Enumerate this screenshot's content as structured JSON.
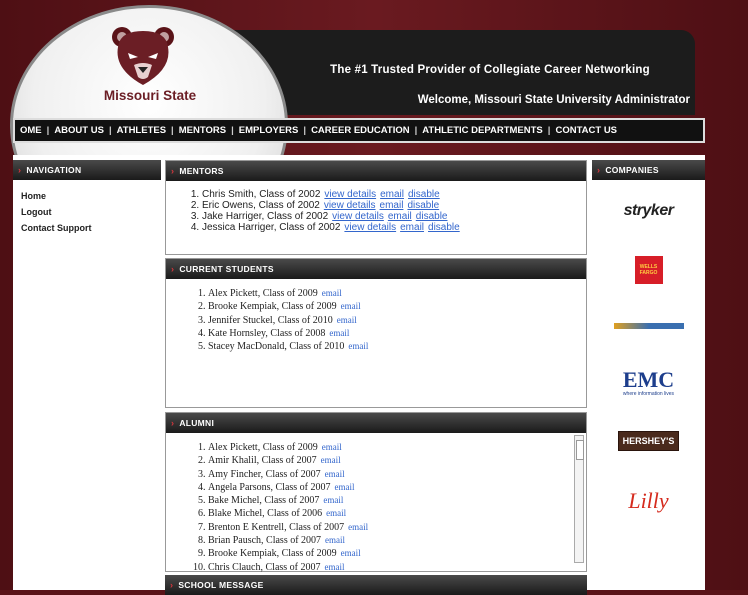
{
  "header": {
    "tagline": "The #1 Trusted Provider of Collegiate Career Networking",
    "welcome": "Welcome, Missouri State University Administrator",
    "school_name": "Missouri State"
  },
  "nav": [
    "OME",
    "ABOUT US",
    "ATHLETES",
    "MENTORS",
    "EMPLOYERS",
    "CAREER EDUCATION",
    "ATHLETIC DEPARTMENTS",
    "CONTACT US"
  ],
  "sidebar": {
    "title": "NAVIGATION",
    "items": [
      "Home",
      "Logout",
      "Contact Support"
    ]
  },
  "mentors": {
    "title": "MENTORS",
    "items": [
      {
        "text": "Chris Smith, Class of 2002",
        "links": [
          "view details",
          "email",
          "disable"
        ]
      },
      {
        "text": "Eric Owens, Class of 2002",
        "links": [
          "view details",
          "email",
          "disable"
        ]
      },
      {
        "text": "Jake Harriger, Class of 2002",
        "links": [
          "view details",
          "email",
          "disable"
        ]
      },
      {
        "text": "Jessica Harriger, Class of 2002",
        "links": [
          "view details",
          "email",
          "disable"
        ]
      }
    ]
  },
  "current_students": {
    "title": "CURRENT STUDENTS",
    "items": [
      {
        "text": "Alex Pickett, Class of 2009",
        "link": "email"
      },
      {
        "text": "Brooke Kempiak, Class of 2009",
        "link": "email"
      },
      {
        "text": "Jennifer Stuckel, Class of 2010",
        "link": "email"
      },
      {
        "text": "Kate Hornsley, Class of 2008",
        "link": "email"
      },
      {
        "text": "Stacey MacDonald, Class of 2010",
        "link": "email"
      }
    ]
  },
  "alumni": {
    "title": "ALUMNI",
    "items": [
      {
        "text": "Alex Pickett, Class of 2009",
        "link": "email"
      },
      {
        "text": "Amir Khalil, Class of 2007",
        "link": "email"
      },
      {
        "text": "Amy Fincher, Class of 2007",
        "link": "email"
      },
      {
        "text": "Angela Parsons, Class of 2007",
        "link": "email"
      },
      {
        "text": "Bake Michel, Class of 2007",
        "link": "email"
      },
      {
        "text": "Blake Michel, Class of 2006",
        "link": "email"
      },
      {
        "text": "Brenton E Kentrell, Class of 2007",
        "link": "email"
      },
      {
        "text": "Brian Pausch, Class of 2007",
        "link": "email"
      },
      {
        "text": "Brooke Kempiak, Class of 2009",
        "link": "email"
      },
      {
        "text": "Chris Clauch, Class of 2007",
        "link": "email"
      }
    ]
  },
  "school_message": {
    "title": "SCHOOL MESSAGE"
  },
  "companies": {
    "title": "COMPANIES",
    "logos": [
      "stryker",
      "WELLS FARGO",
      "EMC",
      "HERSHEY'S",
      "Lilly"
    ],
    "emc_sub": "where information lives"
  },
  "colors": {
    "maroon": "#5a1318",
    "brand": "#6b1e25",
    "link": "#3366cc",
    "accent": "#d4363d"
  }
}
